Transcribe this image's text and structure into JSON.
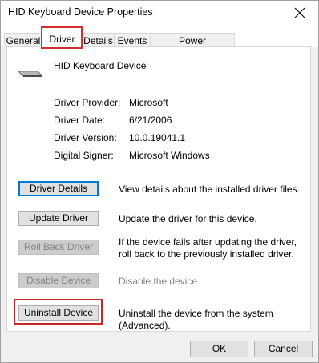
{
  "window": {
    "title": "HID Keyboard Device Properties"
  },
  "tabs": [
    {
      "label": "General"
    },
    {
      "label": "Driver"
    },
    {
      "label": "Details"
    },
    {
      "label": "Events"
    },
    {
      "label": "Power Management"
    }
  ],
  "active_tab": "Driver",
  "device": {
    "name": "HID Keyboard Device",
    "icon": "keyboard-icon"
  },
  "info": [
    {
      "label": "Driver Provider:",
      "value": "Microsoft"
    },
    {
      "label": "Driver Date:",
      "value": "6/21/2006"
    },
    {
      "label": "Driver Version:",
      "value": "10.0.19041.1"
    },
    {
      "label": "Digital Signer:",
      "value": "Microsoft Windows"
    }
  ],
  "actions": [
    {
      "button": "Driver Details",
      "description": "View details about the installed driver files."
    },
    {
      "button": "Update Driver",
      "description": "Update the driver for this device."
    },
    {
      "button": "Roll Back Driver",
      "description": "If the device fails after updating the driver, roll back to the previously installed driver."
    },
    {
      "button": "Disable Device",
      "description": "Disable the device."
    },
    {
      "button": "Uninstall Device",
      "description": "Uninstall the device from the system (Advanced)."
    }
  ],
  "footer": {
    "ok": "OK",
    "cancel": "Cancel"
  },
  "colors": {
    "highlight": "#d32f2f",
    "focus": "#0078d7"
  }
}
